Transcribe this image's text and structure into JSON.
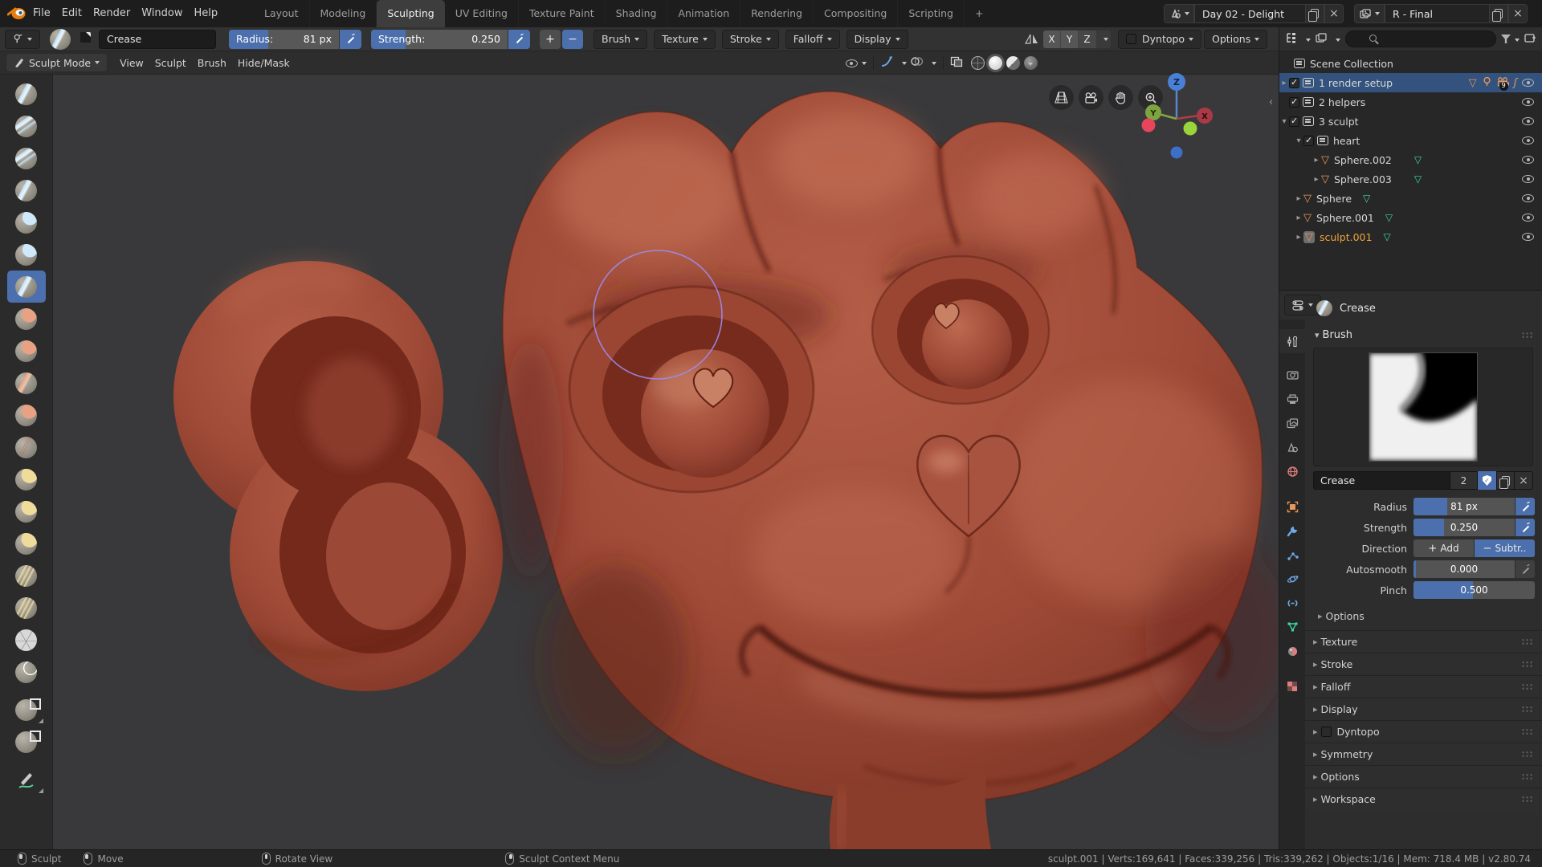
{
  "topbar": {
    "menus": [
      "File",
      "Edit",
      "Render",
      "Window",
      "Help"
    ],
    "tabs": [
      "Layout",
      "Modeling",
      "Sculpting",
      "UV Editing",
      "Texture Paint",
      "Shading",
      "Animation",
      "Rendering",
      "Compositing",
      "Scripting"
    ],
    "active_tab": "Sculpting",
    "add_tab": "+",
    "scene_name": "Day 02 - Delight",
    "view_layer_name": "R - Final"
  },
  "tool_header": {
    "brush_name": "Crease",
    "radius_label": "Radius:",
    "radius_value": "81 px",
    "strength_label": "Strength:",
    "strength_value": "0.250",
    "plus": "+",
    "minus": "−",
    "menus": [
      "Brush",
      "Texture",
      "Stroke",
      "Falloff",
      "Display"
    ],
    "sym_x": "X",
    "sym_y": "Y",
    "sym_z": "Z",
    "dyntopo": "Dyntopo",
    "options": "Options"
  },
  "viewport": {
    "mode": "Sculpt Mode",
    "menus": [
      "View",
      "Sculpt",
      "Brush",
      "Hide/Mask"
    ],
    "gizmo": {
      "x": "X",
      "y": "Y",
      "z": "Z"
    }
  },
  "toolbar": {
    "active_tool": "Crease",
    "tools": [
      "Draw",
      "Clay",
      "Clay Strips",
      "Layer",
      "Inflate",
      "Blob",
      "Crease",
      "Smooth",
      "Flatten",
      "Scrape",
      "Fill",
      "Pinch",
      "Grab",
      "Snake Hook",
      "Thumb",
      "Nudge",
      "Rotate",
      "Simplify",
      "Mask",
      "Box Hide",
      "Box Mask",
      "Annotate"
    ]
  },
  "outliner": {
    "rows": [
      {
        "label": "Scene Collection"
      },
      {
        "label": "1 render setup",
        "badge": "9"
      },
      {
        "label": "2 helpers"
      },
      {
        "label": "3 sculpt"
      },
      {
        "label": "heart"
      },
      {
        "label": "Sphere.002"
      },
      {
        "label": "Sphere.003"
      },
      {
        "label": "Sphere"
      },
      {
        "label": "Sphere.001"
      },
      {
        "label": "sculpt.001"
      }
    ]
  },
  "properties": {
    "tabs": [
      "Tool",
      "Render",
      "Output",
      "View Layer",
      "Scene",
      "World",
      "Object",
      "Modifiers",
      "Particles",
      "Physics",
      "Constraints",
      "Object Data",
      "Material",
      "Texture"
    ],
    "breadcrumb": "Crease",
    "brush_panel_title": "Brush",
    "brush_name": "Crease",
    "brush_users": "2",
    "rows": {
      "radius": {
        "label": "Radius",
        "value": "81 px"
      },
      "strength": {
        "label": "Strength",
        "value": "0.250"
      },
      "direction": {
        "label": "Direction",
        "add": "Add",
        "subtract": "Subtr.."
      },
      "autosmooth": {
        "label": "Autosmooth",
        "value": "0.000"
      },
      "pinch": {
        "label": "Pinch",
        "value": "0.500"
      }
    },
    "subpanels": [
      "Options"
    ],
    "panels": [
      "Texture",
      "Stroke",
      "Falloff",
      "Display",
      "Dyntopo",
      "Symmetry",
      "Options",
      "Workspace"
    ]
  },
  "statusbar": {
    "items": [
      "Sculpt",
      "Move",
      "Rotate View",
      "Sculpt Context Menu"
    ],
    "stats": "sculpt.001 | Verts:169,641 | Faces:339,256 | Tris:339,262 | Objects:1/16 | Mem: 718.4 MB | v2.80.74"
  },
  "colors": {
    "accent_blue": "#4c70ae",
    "selection_blue": "#33527e",
    "object_orange": "#e8975a",
    "mesh_green": "#41d6a2",
    "sculpt_base": "#a04b38",
    "viewport_bg": "#39393b"
  }
}
